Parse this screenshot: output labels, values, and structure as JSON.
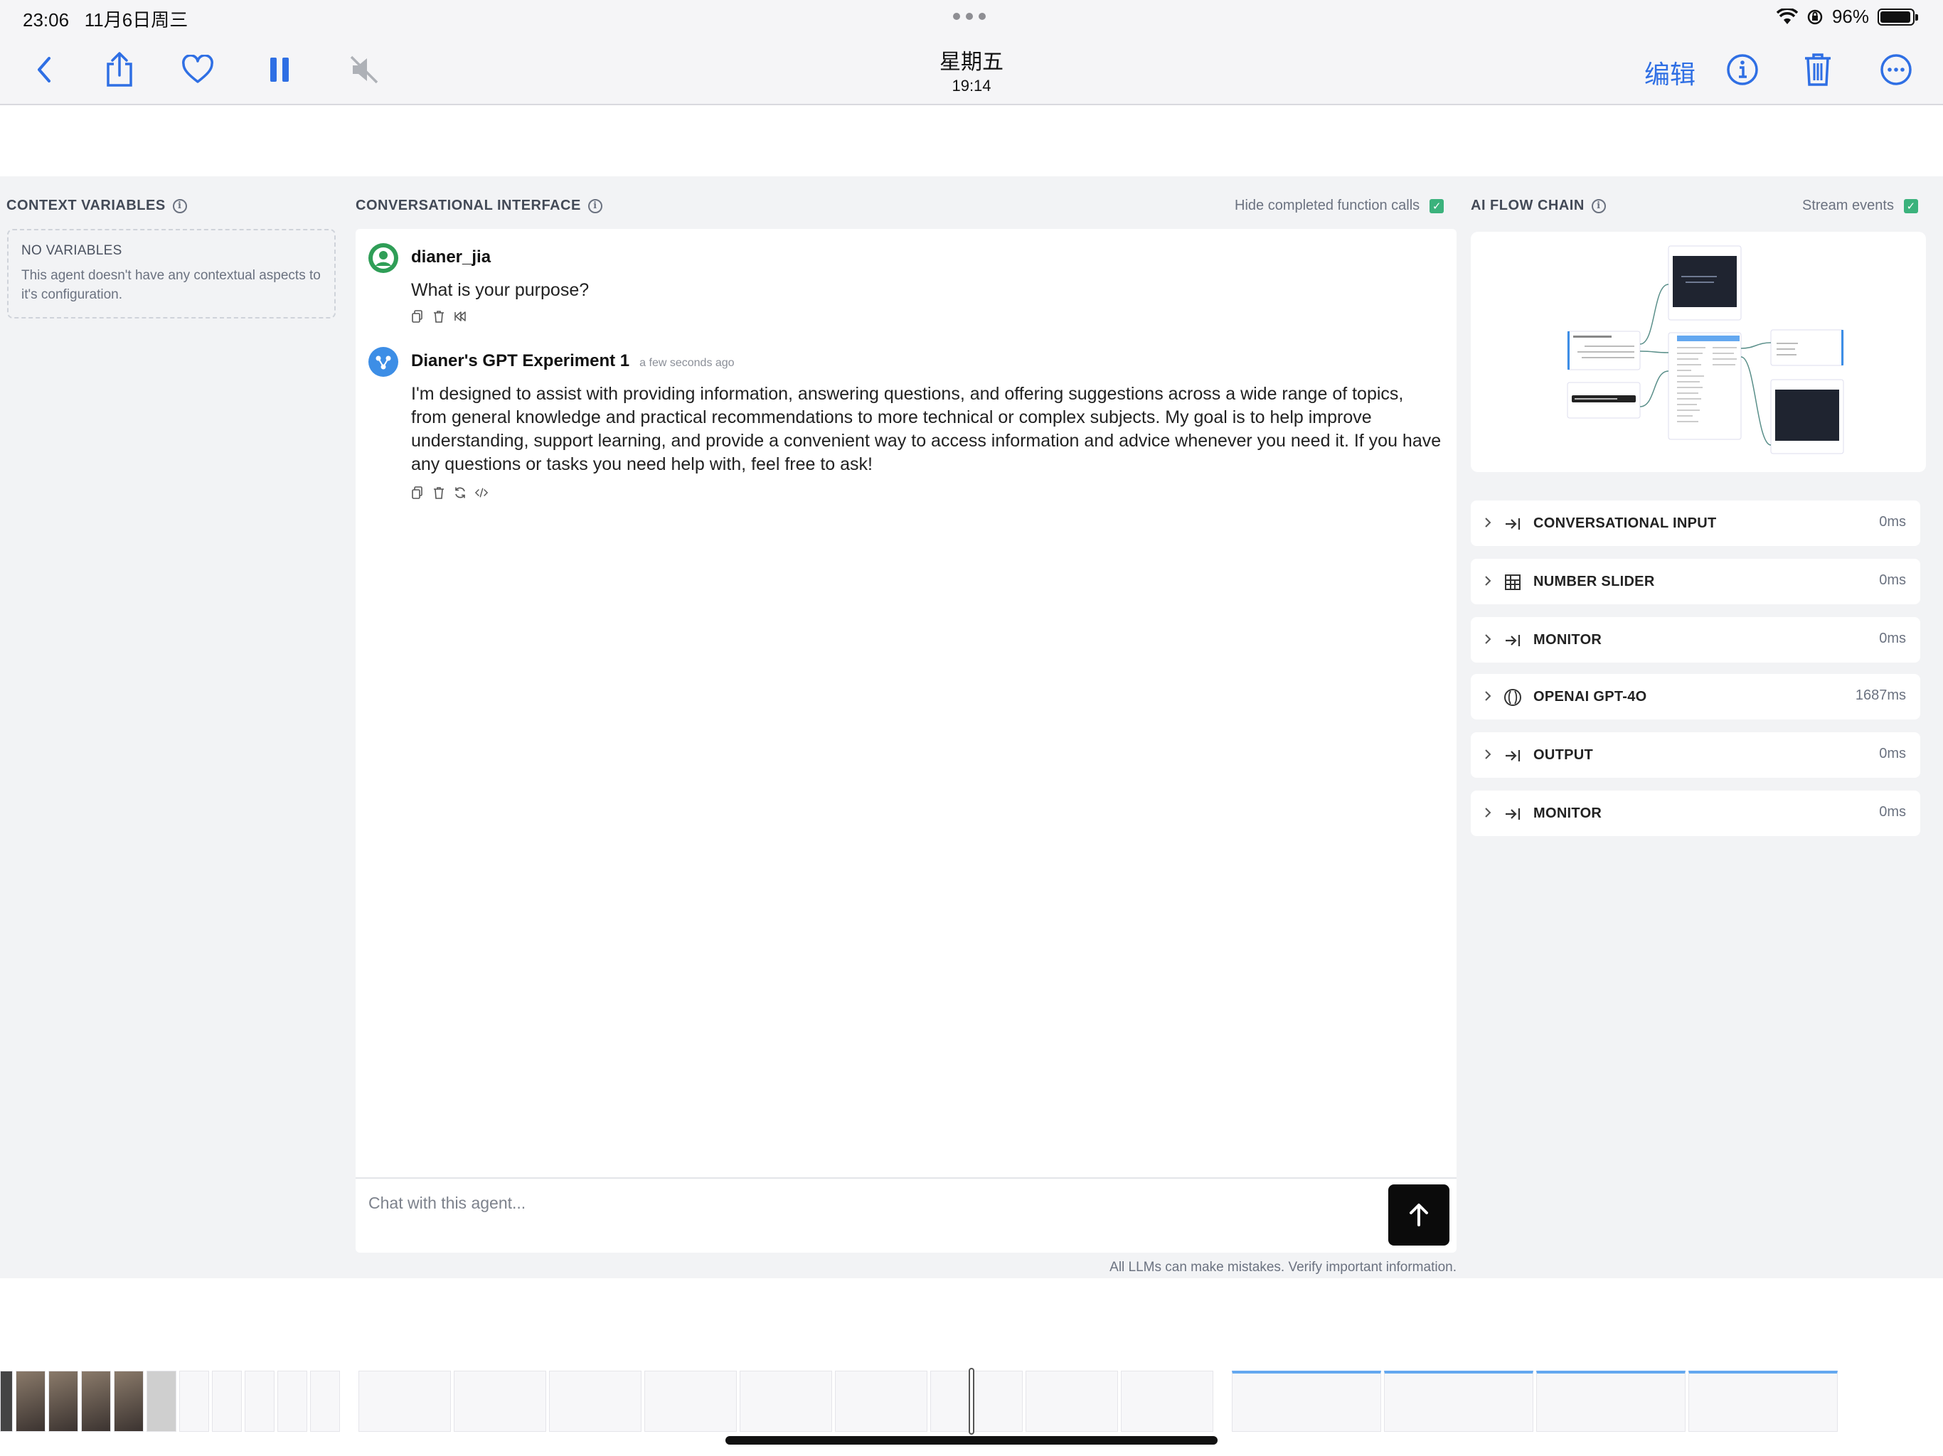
{
  "status_bar": {
    "time": "23:06",
    "date": "11月6日周三",
    "battery": "96%",
    "battery_level": 0.96
  },
  "nav": {
    "day": "星期五",
    "time": "19:14",
    "edit_label": "编辑"
  },
  "context_variables": {
    "heading": "CONTEXT VARIABLES",
    "empty_title": "NO VARIABLES",
    "empty_text": "This agent doesn't have any contextual aspects to it's configuration."
  },
  "chat": {
    "heading": "CONVERSATIONAL INTERFACE",
    "hide_label": "Hide completed function calls",
    "messages": [
      {
        "author": "dianer_jia",
        "time": "",
        "text": "What is your purpose?"
      },
      {
        "author": "Dianer's GPT Experiment 1",
        "time": "a few seconds ago",
        "text": "I'm designed to assist with providing information, answering questions, and offering suggestions across a wide range of topics, from general knowledge and practical recommendations to more technical or complex subjects. My goal is to help improve understanding, support learning, and provide a convenient way to access information and advice whenever you need it. If you have any questions or tasks you need help with, feel free to ask!"
      }
    ],
    "input_placeholder": "Chat with this agent...",
    "disclaimer": "All LLMs can make mistakes. Verify important information."
  },
  "flow_chain": {
    "heading": "AI FLOW CHAIN",
    "stream_label": "Stream events",
    "steps": [
      {
        "name": "CONVERSATIONAL INPUT",
        "duration": "0ms",
        "icon": "arrow-to-line-icon"
      },
      {
        "name": "NUMBER SLIDER",
        "duration": "0ms",
        "icon": "grid-icon"
      },
      {
        "name": "MONITOR",
        "duration": "0ms",
        "icon": "arrow-to-line-icon"
      },
      {
        "name": "OPENAI GPT-4O",
        "duration": "1687ms",
        "icon": "openai-icon"
      },
      {
        "name": "OUTPUT",
        "duration": "0ms",
        "icon": "arrow-to-line-icon"
      },
      {
        "name": "MONITOR",
        "duration": "0ms",
        "icon": "arrow-to-line-icon"
      }
    ]
  },
  "colors": {
    "accent": "#2f6fe4",
    "check_green": "#3bb27c",
    "user_avatar": "#2f9e57",
    "bot_avatar": "#3d8ee6"
  }
}
